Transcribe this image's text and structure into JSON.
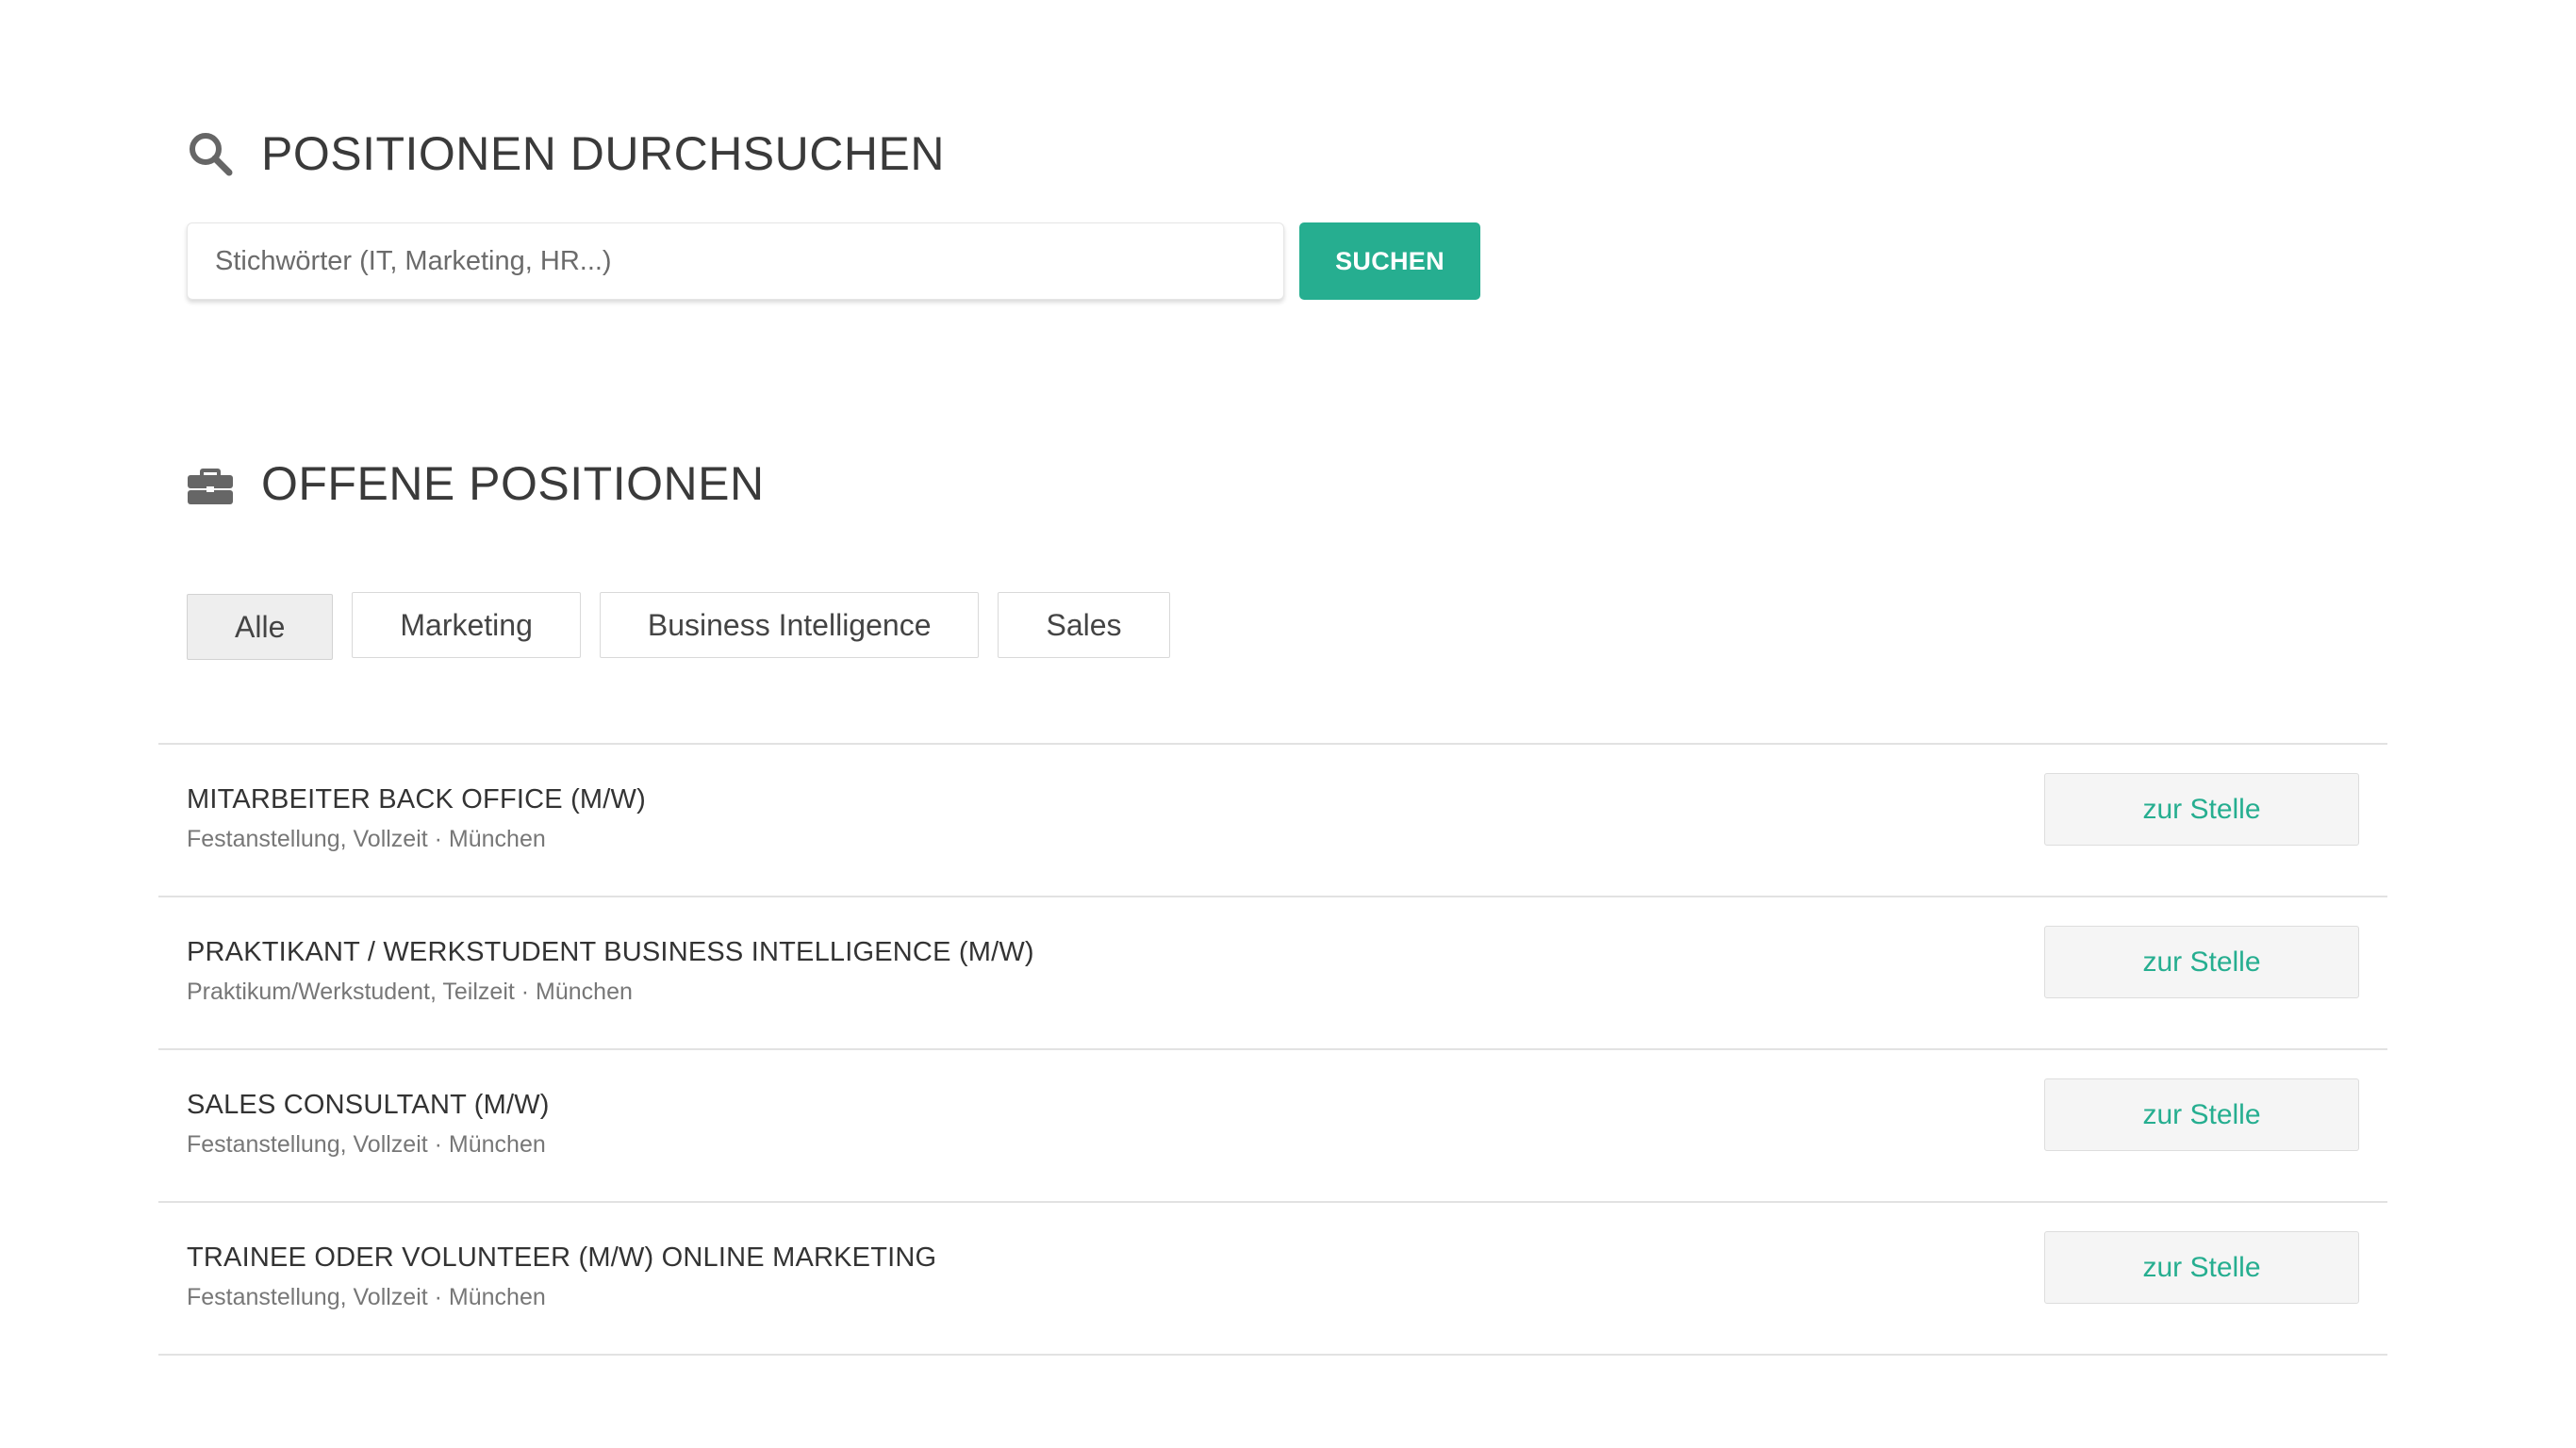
{
  "search": {
    "heading": "POSITIONEN DURCHSUCHEN",
    "heading_icon": "search-icon",
    "placeholder": "Stichwörter (IT, Marketing, HR...)",
    "value": "",
    "button_label": "SUCHEN"
  },
  "positions": {
    "heading": "OFFENE POSITIONEN",
    "heading_icon": "briefcase-icon",
    "filters": [
      {
        "label": "Alle",
        "active": true
      },
      {
        "label": "Marketing",
        "active": false
      },
      {
        "label": "Business Intelligence",
        "active": false
      },
      {
        "label": "Sales",
        "active": false
      }
    ],
    "jobs": [
      {
        "title": "MITARBEITER BACK OFFICE (M/W)",
        "meta": "Festanstellung, Vollzeit · München",
        "button_label": "zur Stelle"
      },
      {
        "title": "PRAKTIKANT / WERKSTUDENT BUSINESS INTELLIGENCE (M/W)",
        "meta": "Praktikum/Werkstudent, Teilzeit · München",
        "button_label": "zur Stelle"
      },
      {
        "title": "SALES CONSULTANT (M/W)",
        "meta": "Festanstellung, Vollzeit · München",
        "button_label": "zur Stelle"
      },
      {
        "title": "TRAINEE ODER VOLUNTEER (M/W) ONLINE MARKETING",
        "meta": "Festanstellung, Vollzeit · München",
        "button_label": "zur Stelle"
      }
    ]
  },
  "colors": {
    "accent": "#26ae90",
    "text": "#333333",
    "muted": "#777777",
    "icon": "#666666",
    "divider": "#e2e2e2"
  }
}
